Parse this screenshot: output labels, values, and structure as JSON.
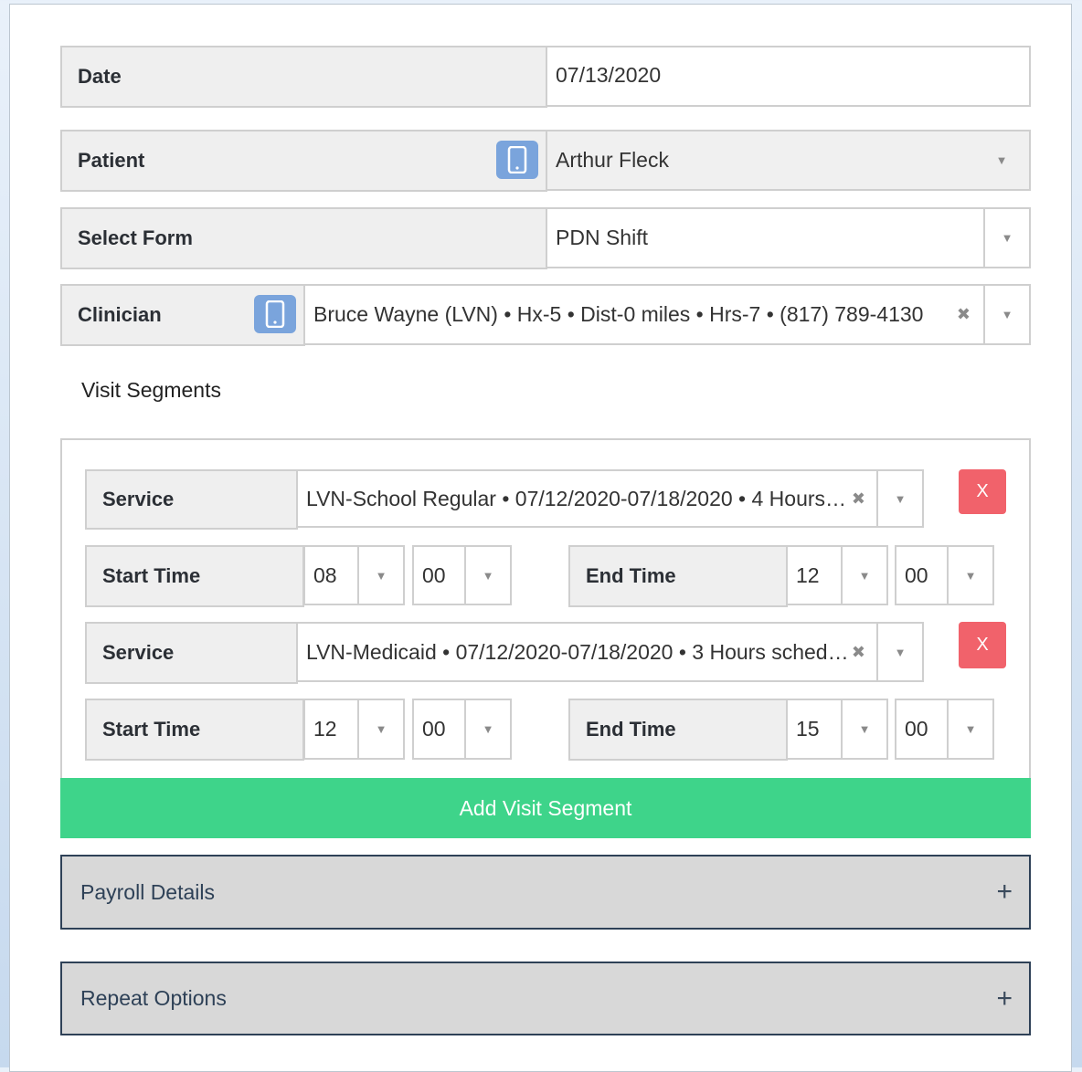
{
  "form": {
    "date": {
      "label": "Date",
      "value": "07/13/2020"
    },
    "patient": {
      "label": "Patient",
      "value": "Arthur Fleck",
      "icon": "mobile-phone-icon"
    },
    "select_form": {
      "label": "Select Form",
      "value": "PDN Shift"
    },
    "clinician": {
      "label": "Clinician",
      "value": "Bruce Wayne (LVN) • Hx-5 • Dist-0 miles • Hrs-7 • (817) 789-4130",
      "icon": "mobile-phone-icon"
    }
  },
  "visit_segments": {
    "title": "Visit Segments",
    "service_label": "Service",
    "start_label": "Start Time",
    "end_label": "End Time",
    "remove_label": "X",
    "segments": [
      {
        "service": "LVN-School Regular • 07/12/2020-07/18/2020 • 4 Hours…",
        "start_h": "08",
        "start_m": "00",
        "end_h": "12",
        "end_m": "00"
      },
      {
        "service": "LVN-Medicaid • 07/12/2020-07/18/2020 • 3 Hours sched…",
        "start_h": "12",
        "start_m": "00",
        "end_h": "15",
        "end_m": "00"
      }
    ],
    "add_label": "Add Visit Segment"
  },
  "accordions": {
    "payroll": "Payroll Details",
    "repeat": "Repeat Options",
    "expand_glyph": "+"
  },
  "glyphs": {
    "dropdown": "▼",
    "clear": "✖"
  },
  "colors": {
    "add_button": "#3ed48a",
    "remove_button": "#f1626b",
    "mobile_icon": "#7aa4dc",
    "accordion_border": "#2e4157"
  }
}
